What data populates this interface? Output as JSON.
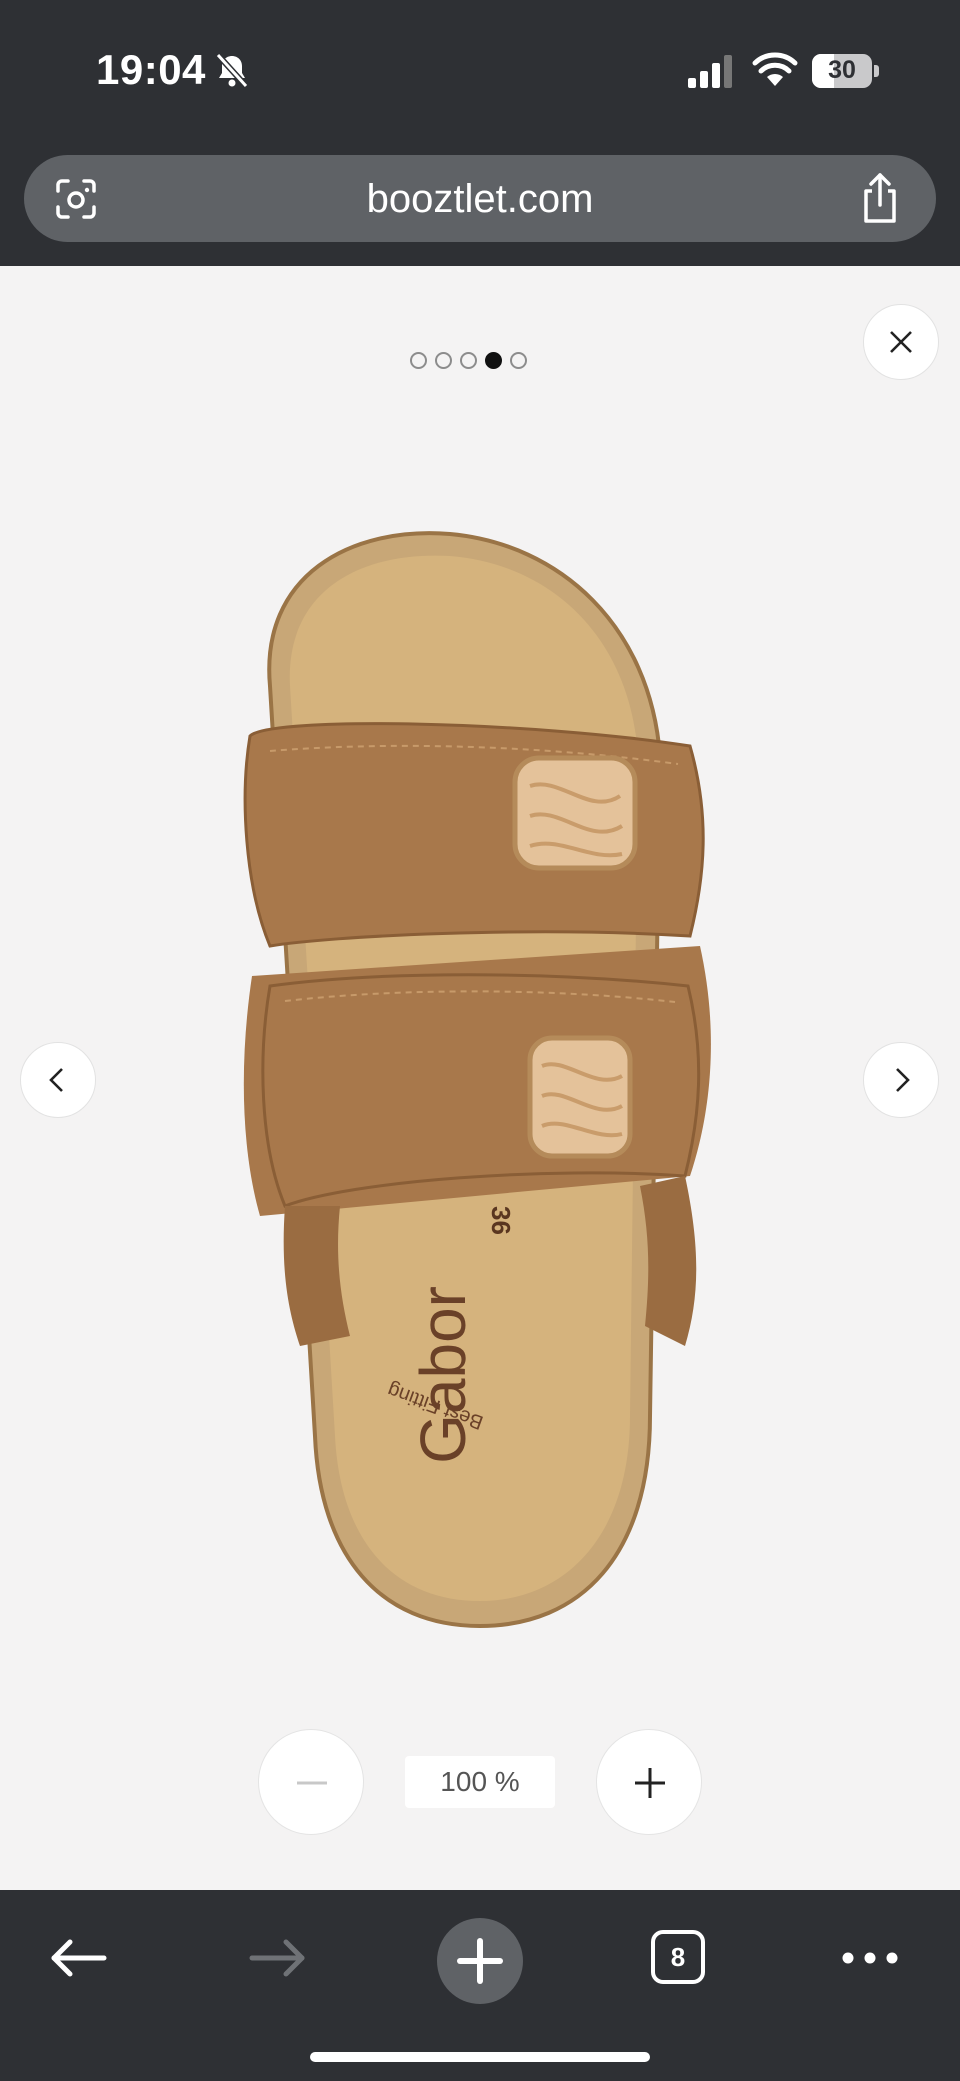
{
  "status": {
    "time": "19:04",
    "battery": "30"
  },
  "browser": {
    "url": "booztlet.com",
    "tab_count": "8"
  },
  "viewer": {
    "carousel_dots": 5,
    "active_dot": 4,
    "zoom_level": "100 %",
    "product": {
      "brand": "Gabor",
      "size": "36",
      "tagline": "Best Fitting"
    }
  },
  "colors": {
    "chrome": "#2e3034",
    "urlbar": "#5f6266",
    "background": "#f4f3f3",
    "suede": "#a8784b",
    "footbed": "#d4b07a"
  }
}
